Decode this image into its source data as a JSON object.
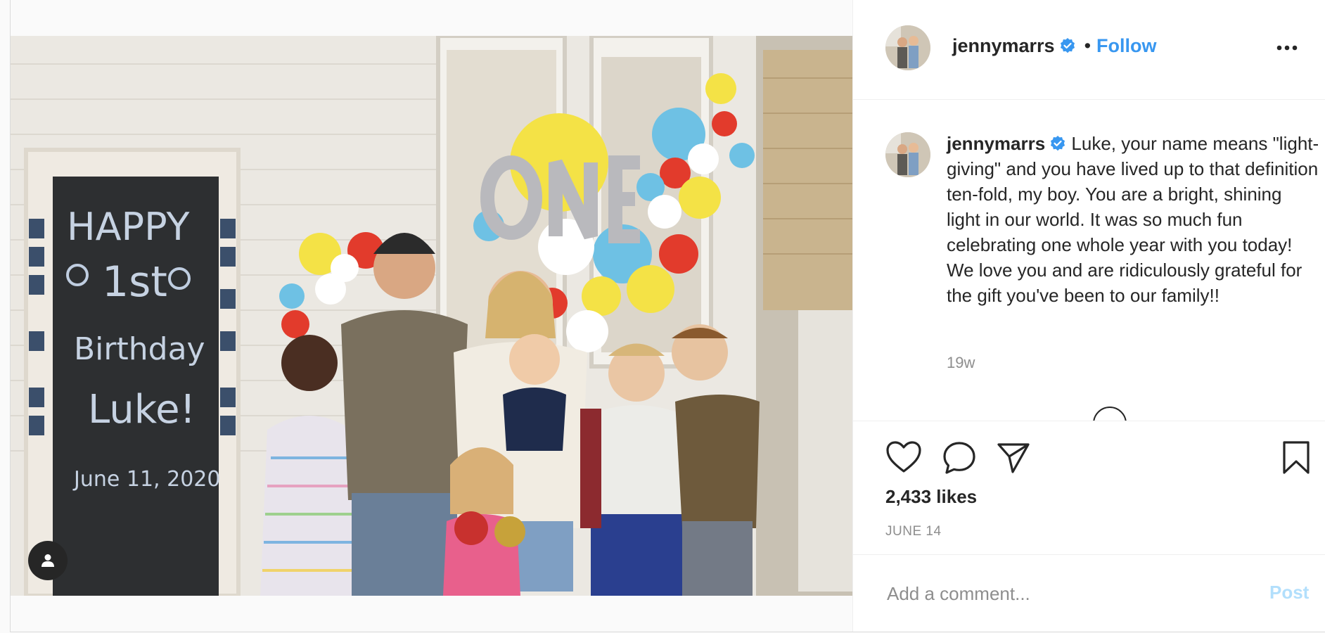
{
  "post": {
    "username": "jennymarrs",
    "verified": true,
    "separator": "•",
    "follow_label": "Follow",
    "more_icon": "more-options-icon",
    "photo_alt": "Family photo at a first birthday party",
    "user_tag_icon": "user-tag-icon"
  },
  "caption": {
    "username": "jennymarrs",
    "text": "Luke, your name means \"light-giving\" and you have lived up to that definition ten-fold, my boy. You are a bright, shining light in our world. It was so much fun celebrating one whole year with you today! We love you and are ridiculously grateful for the gift you've been to our family!!",
    "time_ago": "19w"
  },
  "actions": {
    "like_icon": "heart-icon",
    "comment_icon": "comment-icon",
    "share_icon": "share-icon",
    "save_icon": "bookmark-icon",
    "likes": "2,433 likes",
    "date": "JUNE 14"
  },
  "comment": {
    "placeholder": "Add a comment...",
    "post_label": "Post"
  },
  "colors": {
    "link": "#3897f0",
    "post_disabled": "#b2dffc",
    "secondary_text": "#8e8e8e",
    "border": "#efefef"
  }
}
